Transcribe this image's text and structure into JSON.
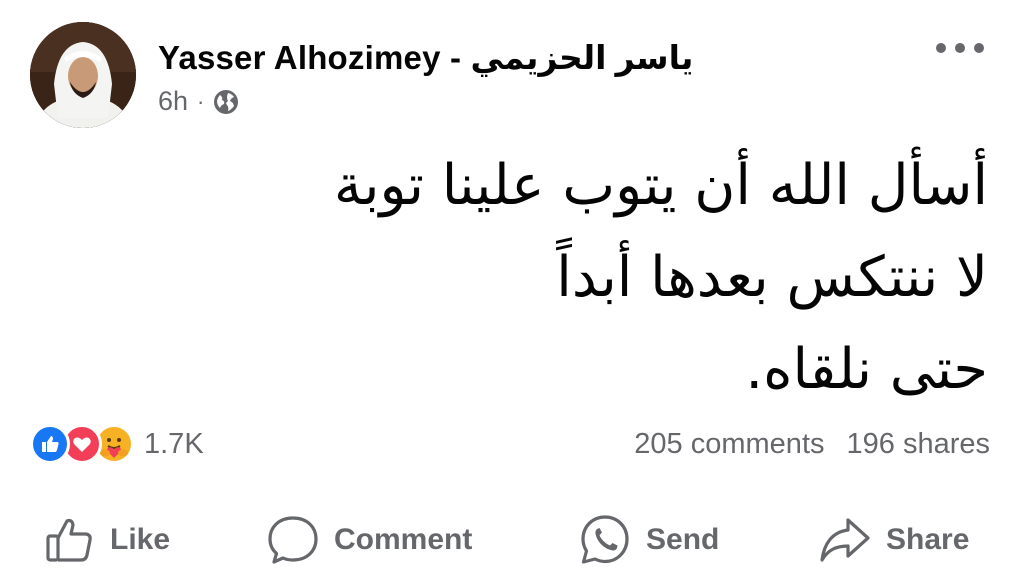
{
  "post": {
    "author": "Yasser Alhozimey - ياسر الحزيمي",
    "time": "6h",
    "separator": "·",
    "audience_icon": "globe-icon",
    "more_icon": "more-options-icon",
    "text_lines": [
      "أسأل الله أن يتوب علينا توبة",
      "لا ننتكس بعدها أبداً",
      "حتى نلقاه."
    ]
  },
  "stats": {
    "reaction_icons": [
      "like-reaction-icon",
      "love-reaction-icon",
      "care-reaction-icon"
    ],
    "reaction_count": "1.7K",
    "comments": "205 comments",
    "shares": "196 shares"
  },
  "actions": {
    "like": "Like",
    "comment": "Comment",
    "send": "Send",
    "share": "Share"
  },
  "colors": {
    "text_primary": "#050505",
    "text_secondary": "#65676b",
    "like_blue": "#1877f2",
    "love_red": "#f33e58",
    "care_yellow": "#f7b125"
  }
}
